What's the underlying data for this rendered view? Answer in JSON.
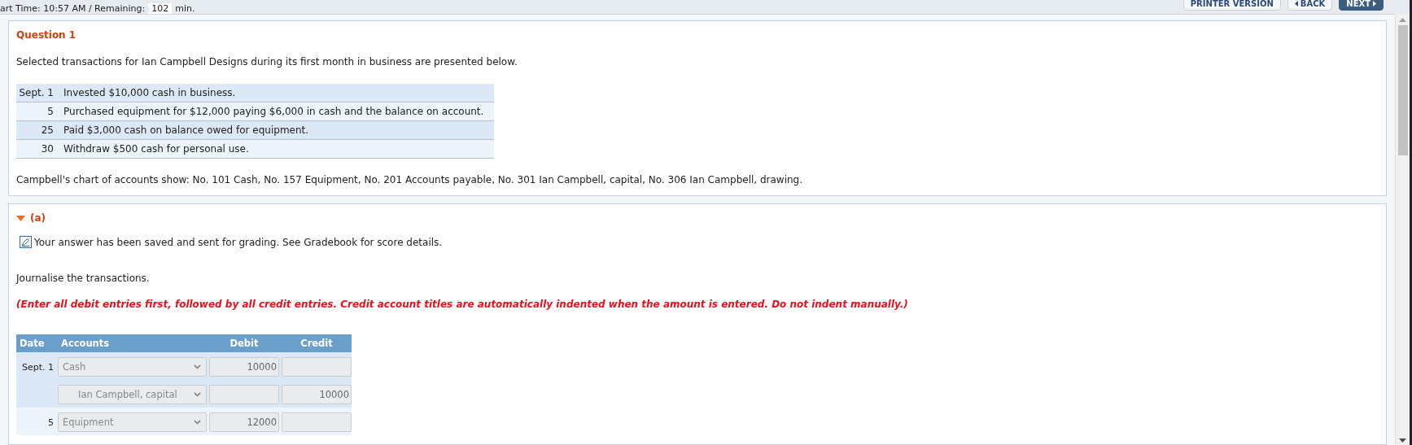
{
  "header": {
    "timer_text": "art Time: 10:57 AM / Remaining:",
    "remaining": "102",
    "unit": "min.",
    "buttons": [
      {
        "label": "PRINTER VERSION",
        "kind": "plain"
      },
      {
        "label": "BACK",
        "kind": "back"
      },
      {
        "label": "NEXT",
        "kind": "next"
      }
    ]
  },
  "question": {
    "title": "Question 1",
    "intro": "Selected transactions for Ian Campbell Designs during its first month in business are presented below.",
    "transactions": [
      {
        "date": "Sept. 1",
        "text": "Invested $10,000 cash in business."
      },
      {
        "date": "5",
        "text": "Purchased equipment for $12,000 paying $6,000 in cash and the balance on account."
      },
      {
        "date": "25",
        "text": "Paid $3,000 cash on balance owed for equipment."
      },
      {
        "date": "30",
        "text": "Withdraw $500 cash for personal use."
      }
    ],
    "accounts_note": "Campbell's chart of accounts show: No. 101 Cash, No. 157 Equipment, No. 201 Accounts payable, No. 301 Ian Campbell, capital, No. 306 Ian Campbell, drawing."
  },
  "part": {
    "label": "(a)",
    "expanded": true,
    "status": "Your answer has been saved and sent for grading. See Gradebook for score details.",
    "instruction": "Journalise the transactions.",
    "note": "(Enter all debit entries first, followed by all credit entries. Credit account titles are automatically indented when the amount is entered. Do not indent manually.)",
    "journal": {
      "columns": [
        "Date",
        "Accounts",
        "Debit",
        "Credit"
      ],
      "entries": [
        {
          "date": "Sept. 1",
          "lines": [
            {
              "account": "Cash",
              "indented": false,
              "debit": "10000"
            },
            {
              "account": "Ian Campbell, capital",
              "indented": true,
              "credit": "10000"
            }
          ]
        },
        {
          "date": "5",
          "lines": [
            {
              "account": "Equipment",
              "indented": false,
              "debit": "12000"
            }
          ]
        }
      ]
    }
  }
}
